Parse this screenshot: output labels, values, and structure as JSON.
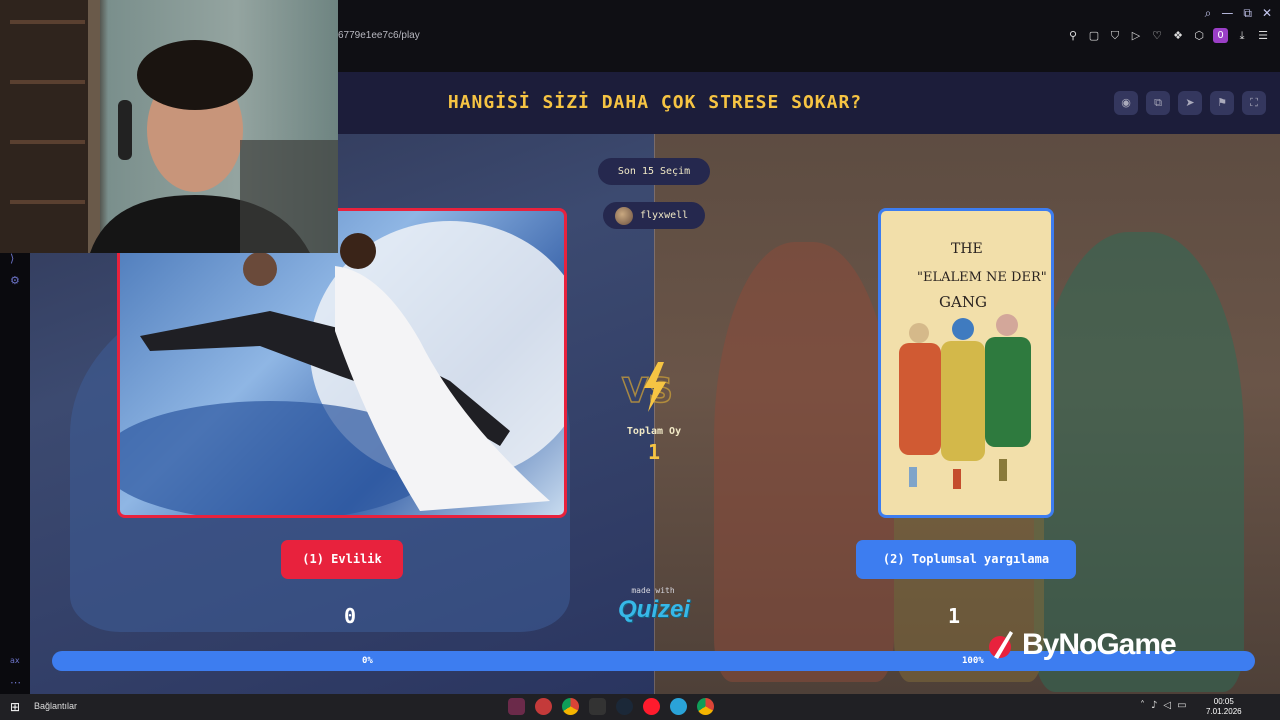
{
  "browser": {
    "url": "6779e1ee7c6/play",
    "window_controls": [
      "⌕",
      "—",
      "⧉",
      "✕"
    ],
    "toolbar_icons": [
      "⚲",
      "▢",
      "⛉",
      "▷",
      "♡",
      "❖",
      "⬡"
    ],
    "badge": "0"
  },
  "quiz": {
    "question": "HANGİSİ SİZİ DAHA ÇOK STRESE SOKAR?",
    "last_picks_label": "Son 15 Seçim",
    "player_name": "flyxwell",
    "total_votes_label": "Toplam Oy",
    "total_votes": "1",
    "vs_label": "VS",
    "option_a": {
      "label": "(1) Evlilik",
      "votes": "0",
      "percent": "0%",
      "color": "#e8223d"
    },
    "option_b": {
      "label": "(2) Toplumsal yargılama",
      "votes": "1",
      "percent": "100%",
      "color": "#3d7df0"
    },
    "made_with": "made with",
    "brand": "Quizei",
    "share_a": 0,
    "image_b_text": {
      "line1": "THE",
      "line2": "\"ELALEM NE DER\"",
      "line3": "GANG"
    }
  },
  "overlay": {
    "sponsor": "ByNoGame"
  },
  "taskbar": {
    "label": "Bağlantılar",
    "time": "00:05",
    "date": "7.01.2026"
  },
  "colors": {
    "accent_gold": "#f6c443",
    "header_bg": "#1c1d3a"
  }
}
